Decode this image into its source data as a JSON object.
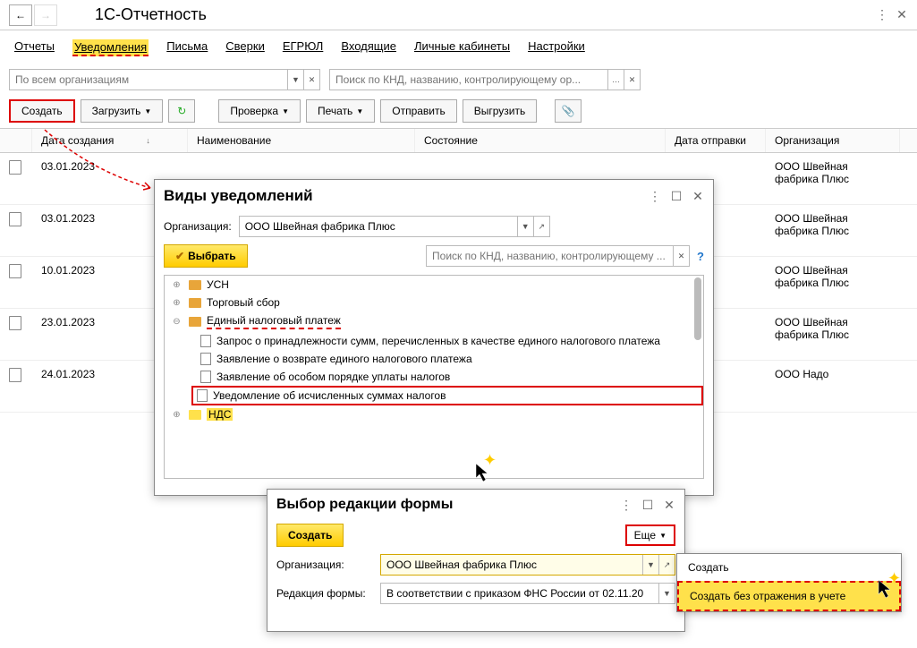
{
  "titlebar": {
    "title": "1С-Отчетность"
  },
  "tabs": [
    "Отчеты",
    "Уведомления",
    "Письма",
    "Сверки",
    "ЕГРЮЛ",
    "Входящие",
    "Личные кабинеты",
    "Настройки"
  ],
  "filters": {
    "org_placeholder": "По всем организациям",
    "search_placeholder": "Поиск по КНД, названию, контролирующему ор..."
  },
  "toolbar": {
    "create": "Создать",
    "load": "Загрузить",
    "check": "Проверка",
    "print": "Печать",
    "send": "Отправить",
    "export": "Выгрузить"
  },
  "table": {
    "headers": {
      "date": "Дата создания",
      "name": "Наименование",
      "state": "Состояние",
      "sent": "Дата отправки",
      "org": "Организация"
    },
    "rows": [
      {
        "date": "03.01.2023",
        "org": "ООО Швейная фабрика Плюс"
      },
      {
        "date": "03.01.2023",
        "org": "ООО Швейная фабрика Плюс"
      },
      {
        "date": "10.01.2023",
        "org": "ООО Швейная фабрика Плюс"
      },
      {
        "date": "23.01.2023",
        "org": "ООО Швейная фабрика Плюс"
      },
      {
        "date": "24.01.2023",
        "org": "ООО Надо"
      }
    ]
  },
  "subwin1": {
    "title": "Виды уведомлений",
    "org_label": "Организация:",
    "org_value": "ООО Швейная фабрика Плюс",
    "select_btn": "Выбрать",
    "search_placeholder": "Поиск по КНД, названию, контролирующему ...",
    "tree": {
      "usn": "УСН",
      "sbor": "Торговый сбор",
      "enp": "Единый налоговый платеж",
      "docs": [
        "Запрос о принадлежности сумм, перечисленных в качестве единого налогового платежа",
        "Заявление о возврате единого налогового платежа",
        "Заявление об особом порядке уплаты налогов",
        "Уведомление об исчисленных суммах налогов"
      ],
      "nds": "НДС"
    }
  },
  "subwin2": {
    "title": "Выбор редакции формы",
    "create": "Создать",
    "more": "Еще",
    "org_label": "Организация:",
    "org_value": "ООО Швейная фабрика Плюс",
    "redaction_label": "Редакция формы:",
    "redaction_value": "В соответствии с приказом ФНС России от 02.11.20"
  },
  "menu": {
    "item1": "Создать",
    "item2": "Создать без отражения в учете"
  }
}
